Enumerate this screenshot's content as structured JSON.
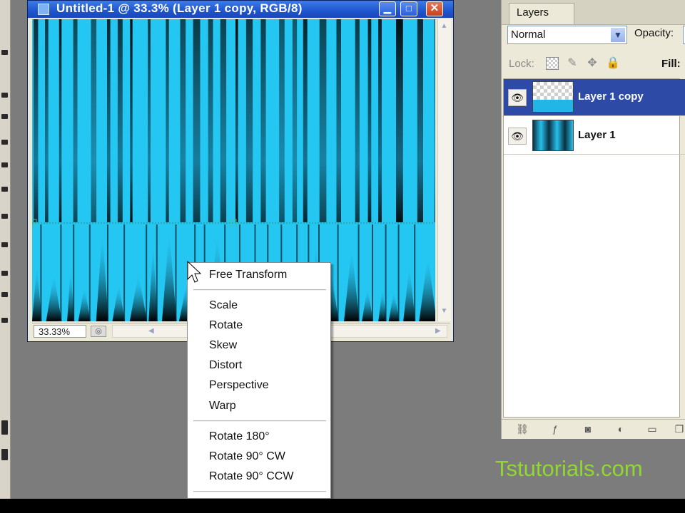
{
  "document": {
    "title": "Untitled-1 @ 33.3% (Layer 1 copy, RGB/8)",
    "zoom": "33.33%",
    "controls": {
      "minimize": "▁",
      "maximize": "□",
      "close": "✕"
    }
  },
  "layers_panel": {
    "tab": "Layers",
    "blend_mode": "Normal",
    "opacity_label": "Opacity:",
    "lock_label": "Lock:",
    "fill_label": "Fill:",
    "layers": [
      {
        "name": "Layer 1 copy",
        "selected": true,
        "visible": true,
        "thumbnail": "transparent-with-stripes"
      },
      {
        "name": "Layer 1",
        "selected": false,
        "visible": true,
        "thumbnail": "stripes"
      }
    ]
  },
  "context_menu": {
    "groups": [
      [
        "Free Transform"
      ],
      [
        "Scale",
        "Rotate",
        "Skew",
        "Distort",
        "Perspective",
        "Warp"
      ],
      [
        "Rotate 180°",
        "Rotate 90° CW",
        "Rotate 90° CCW"
      ]
    ]
  },
  "watermark": "Tstutorials.com",
  "colors": {
    "canvas_cyan": "#24c6f2",
    "selected_layer": "#2c4aa6",
    "titlebar_blue": "#1f55cf",
    "watermark_green": "#90d830"
  },
  "icons": {
    "lock_icons": [
      "lock-transparent-icon",
      "lock-paint-icon",
      "lock-move-icon",
      "lock-all-icon"
    ],
    "footer_icons": [
      "link-layers-icon",
      "layer-style-icon",
      "layer-mask-icon",
      "adjustment-layer-icon",
      "group-icon",
      "new-layer-icon"
    ]
  }
}
